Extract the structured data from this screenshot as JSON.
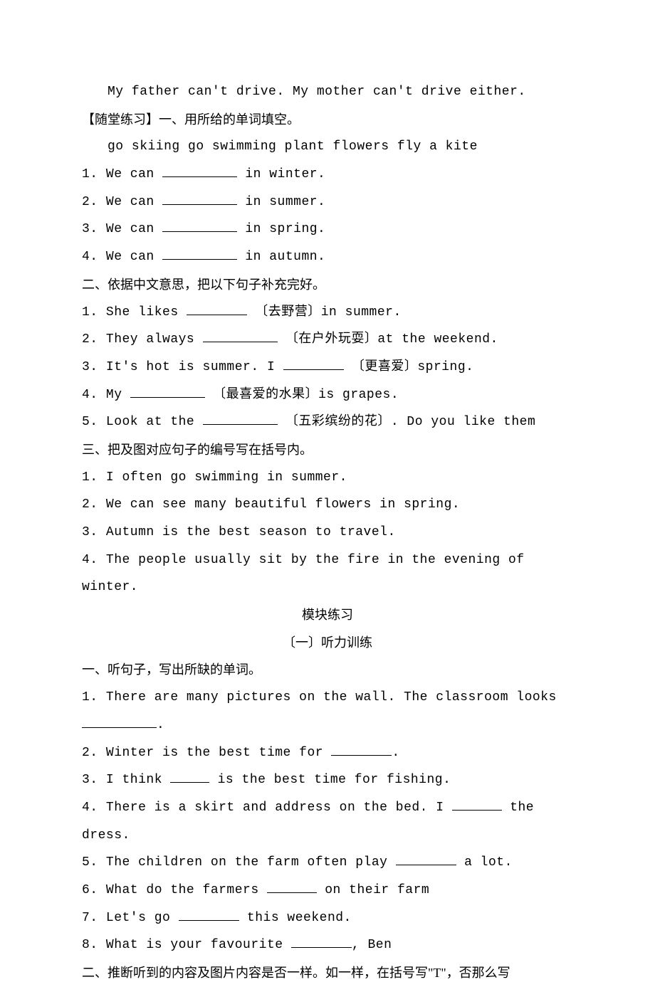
{
  "intro_sentence": "My father can't drive. My mother can't drive either.",
  "classwork_title": "【随堂练习】一、用所给的单词填空。",
  "word_bank": "go skiing    go swimming    plant flowers    fly a kite",
  "ex1": {
    "q1_a": "1. We can ",
    "q1_b": " in winter.",
    "q2_a": "2. We can ",
    "q2_b": " in summer.",
    "q3_a": "3. We can ",
    "q3_b": " in spring.",
    "q4_a": "4. We can ",
    "q4_b": " in autumn."
  },
  "section2_title": "二、依据中文意思，把以下句子补充完好。",
  "ex2": {
    "q1_a": "1. She likes ",
    "q1_b": " 〔去野营〕in summer.",
    "q2_a": "2. They always ",
    "q2_b": " 〔在户外玩耍〕at the weekend.",
    "q3_a": "3. It's hot is summer. I ",
    "q3_b": " 〔更喜爱〕spring.",
    "q4_a": "4. My ",
    "q4_b": " 〔最喜爱的水果〕is grapes.",
    "q5_a": "5. Look at the ",
    "q5_b": " 〔五彩缤纷的花〕. Do you like them"
  },
  "section3_title": "三、把及图对应句子的编号写在括号内。",
  "ex3": {
    "q1": "1. I often go swimming in summer.",
    "q2": "2. We can see many beautiful flowers in spring.",
    "q3": "3. Autumn is the best season to travel.",
    "q4": "4. The people usually sit by the fire in the evening of winter."
  },
  "module_title": "模块练习",
  "listening_title": "〔一〕听力训练",
  "listening_section1_title": "一、听句子，写出所缺的单词。",
  "ex4": {
    "q1_a": "1. There are many pictures on the wall. The classroom looks ",
    "q1_b": ".",
    "q2_a": "2. Winter is the best time for ",
    "q2_b": ".",
    "q3_a": "3. I think ",
    "q3_b": " is the best time for fishing.",
    "q4_a": "4. There is a skirt and address on the bed. I ",
    "q4_b": " the dress.",
    "q5_a": "5. The children on the farm often play ",
    "q5_b": " a lot.",
    "q6_a": "6. What do the farmers ",
    "q6_b": " on their farm",
    "q7_a": "7. Let's go ",
    "q7_b": " this weekend.",
    "q8_a": "8. What is your favourite ",
    "q8_b": ", Ben"
  },
  "listening_section2_title": "二、推断听到的内容及图片内容是否一样。如一样，在括号写\"T\"，否那么写"
}
